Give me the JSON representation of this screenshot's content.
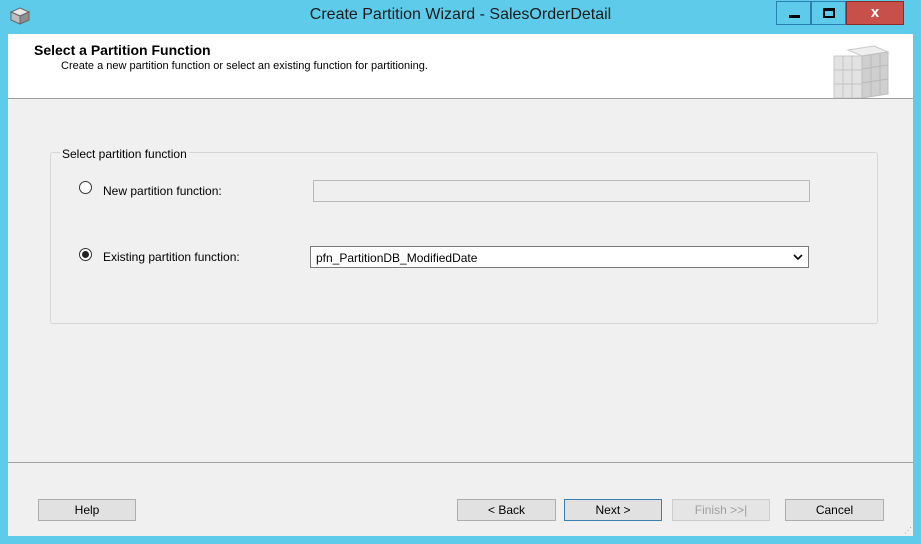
{
  "window": {
    "title": "Create Partition Wizard - SalesOrderDetail",
    "controls": {
      "minimize": "minimize",
      "maximize": "maximize",
      "close": "x"
    }
  },
  "header": {
    "title": "Select a Partition Function",
    "subtitle": "Create a new partition function or select an existing function for partitioning."
  },
  "group": {
    "legend": "Select partition function",
    "options": [
      {
        "label": "New partition function:",
        "selected": false,
        "value": ""
      },
      {
        "label": "Existing partition function:",
        "selected": true,
        "value": "pfn_PartitionDB_ModifiedDate"
      }
    ]
  },
  "footer": {
    "help": "Help",
    "back": "< Back",
    "next": "Next >",
    "finish": "Finish >>|",
    "cancel": "Cancel"
  },
  "colors": {
    "titlebar": "#5ecbea",
    "close": "#c7504a",
    "dialog": "#f0f0f0"
  }
}
